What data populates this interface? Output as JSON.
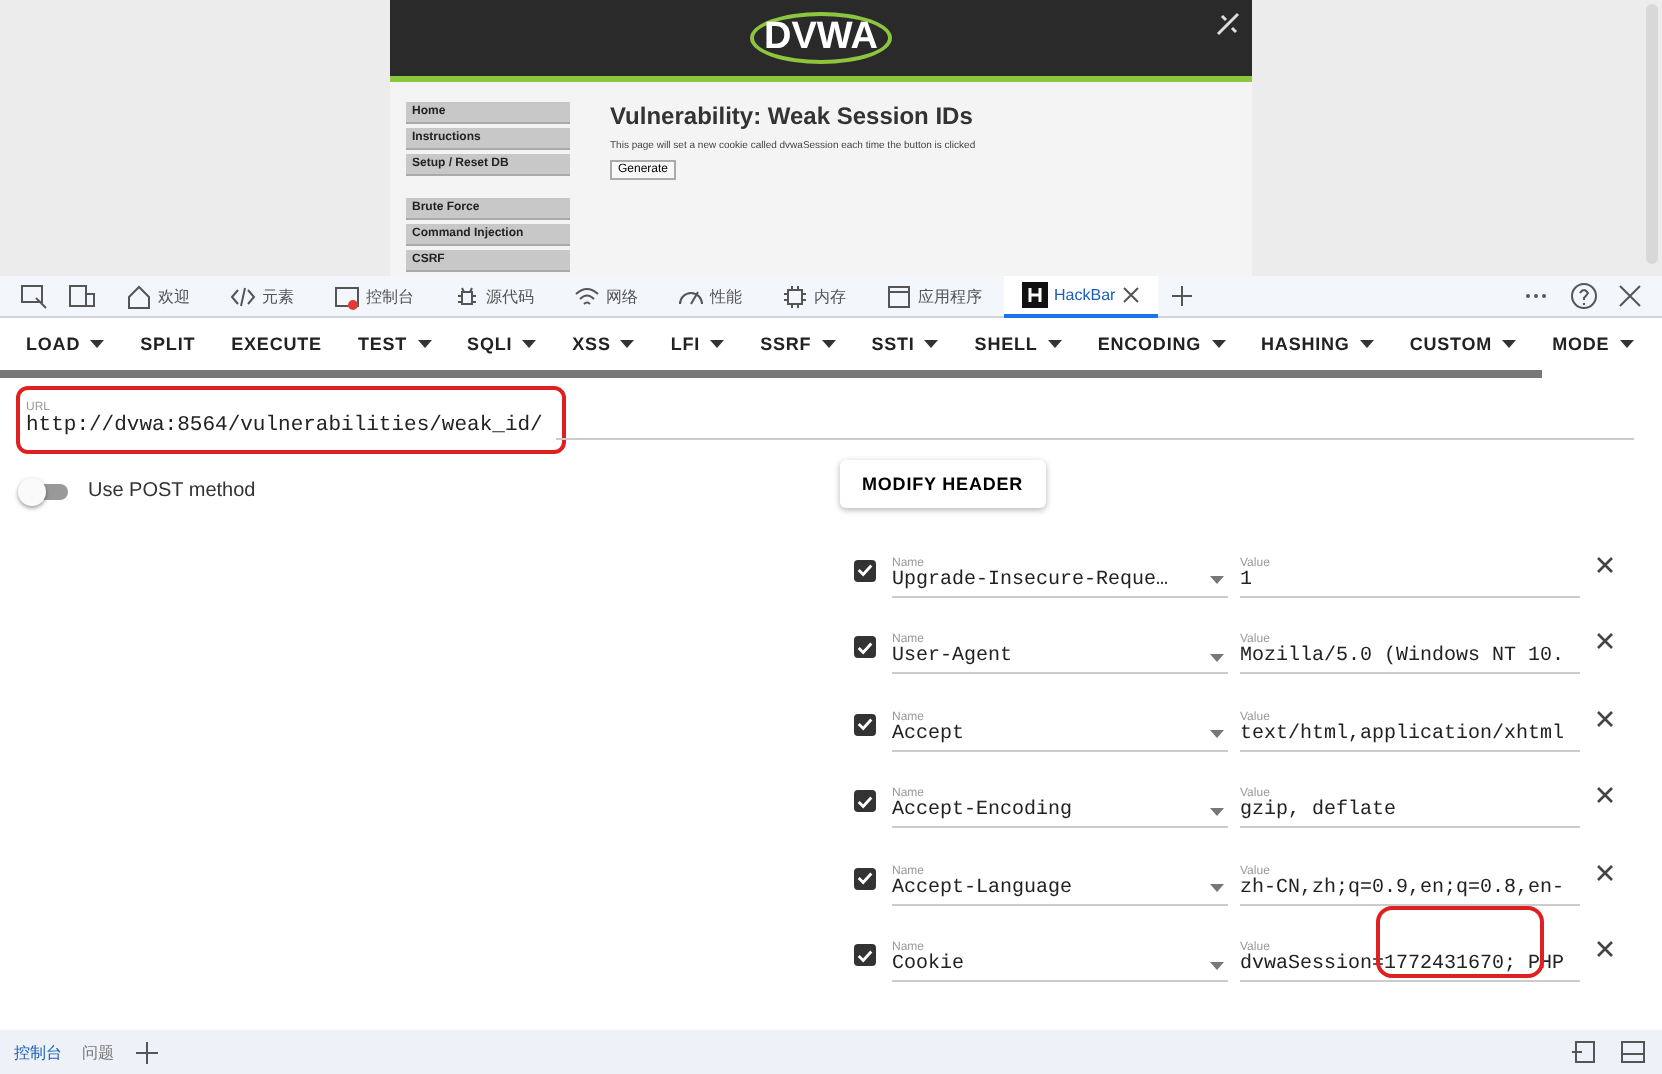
{
  "page": {
    "logo": "DVWA",
    "menu_groups": [
      [
        "Home",
        "Instructions",
        "Setup / Reset DB"
      ],
      [
        "Brute Force",
        "Command Injection",
        "CSRF"
      ]
    ],
    "title": "Vulnerability: Weak Session IDs",
    "text": "This page will set a new cookie called dvwaSession each time the button is clicked",
    "button": "Generate"
  },
  "devtools_tabs": [
    {
      "label": "欢迎",
      "selected": false,
      "badge": false
    },
    {
      "label": "元素",
      "selected": false,
      "badge": false
    },
    {
      "label": "控制台",
      "selected": false,
      "badge": true
    },
    {
      "label": "源代码",
      "selected": false,
      "badge": false
    },
    {
      "label": "网络",
      "selected": false,
      "badge": false
    },
    {
      "label": "性能",
      "selected": false,
      "badge": false
    },
    {
      "label": "内存",
      "selected": false,
      "badge": false
    },
    {
      "label": "应用程序",
      "selected": false,
      "badge": false
    },
    {
      "label": "HackBar",
      "selected": true,
      "badge": false
    }
  ],
  "toolbar": [
    {
      "label": "LOAD",
      "menu": true
    },
    {
      "label": "SPLIT",
      "menu": false
    },
    {
      "label": "EXECUTE",
      "menu": false
    },
    {
      "label": "TEST",
      "menu": true
    },
    {
      "label": "SQLI",
      "menu": true
    },
    {
      "label": "XSS",
      "menu": true
    },
    {
      "label": "LFI",
      "menu": true
    },
    {
      "label": "SSRF",
      "menu": true
    },
    {
      "label": "SSTI",
      "menu": true
    },
    {
      "label": "SHELL",
      "menu": true
    },
    {
      "label": "ENCODING",
      "menu": true
    },
    {
      "label": "HASHING",
      "menu": true
    },
    {
      "label": "CUSTOM",
      "menu": true
    },
    {
      "label": "MODE",
      "menu": true
    }
  ],
  "url": {
    "label": "URL",
    "value": "http://dvwa:8564/vulnerabilities/weak_id/",
    "highlighted": true
  },
  "post": {
    "label": "Use POST method",
    "on": false
  },
  "modify_header": "MODIFY HEADER",
  "headers": [
    {
      "checked": true,
      "name_label": "Name",
      "name": "Upgrade-Insecure-Reque…",
      "value_label": "Value",
      "value": "1",
      "highlighted": false
    },
    {
      "checked": true,
      "name_label": "Name",
      "name": "User-Agent",
      "value_label": "Value",
      "value": "Mozilla/5.0 (Windows NT 10.",
      "highlighted": false
    },
    {
      "checked": true,
      "name_label": "Name",
      "name": "Accept",
      "value_label": "Value",
      "value": "text/html,application/xhtml",
      "highlighted": false
    },
    {
      "checked": true,
      "name_label": "Name",
      "name": "Accept-Encoding",
      "value_label": "Value",
      "value": "gzip, deflate",
      "highlighted": false
    },
    {
      "checked": true,
      "name_label": "Name",
      "name": "Accept-Language",
      "value_label": "Value",
      "value": "zh-CN,zh;q=0.9,en;q=0.8,en-",
      "highlighted": false
    },
    {
      "checked": true,
      "name_label": "Name",
      "name": "Cookie",
      "value_label": "Value",
      "value": "dvwaSession=1772431670; PHP",
      "highlighted": true
    }
  ],
  "drawer_tabs": [
    {
      "label": "控制台",
      "selected": true
    },
    {
      "label": "问题",
      "selected": false
    }
  ]
}
